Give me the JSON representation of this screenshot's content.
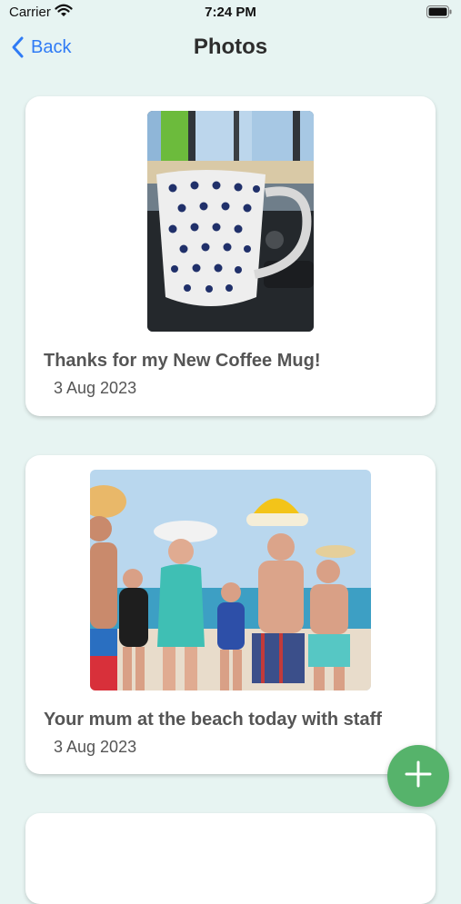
{
  "status_bar": {
    "carrier": "Carrier",
    "time": "7:24 PM"
  },
  "nav": {
    "back_label": "Back",
    "title": "Photos"
  },
  "posts": [
    {
      "title": "Thanks for my New Coffee Mug!",
      "date": "3 Aug 2023",
      "photo": "polka-dot-coffee-mug-photo"
    },
    {
      "title": "Your mum at the beach today with staff",
      "date": "3 Aug 2023",
      "photo": "seniors-at-beach-photo"
    }
  ],
  "colors": {
    "background": "#e7f4f2",
    "accent": "#2f7bf5",
    "fab": "#56b36b",
    "card": "#ffffff"
  },
  "fab": {
    "icon": "plus-icon"
  }
}
